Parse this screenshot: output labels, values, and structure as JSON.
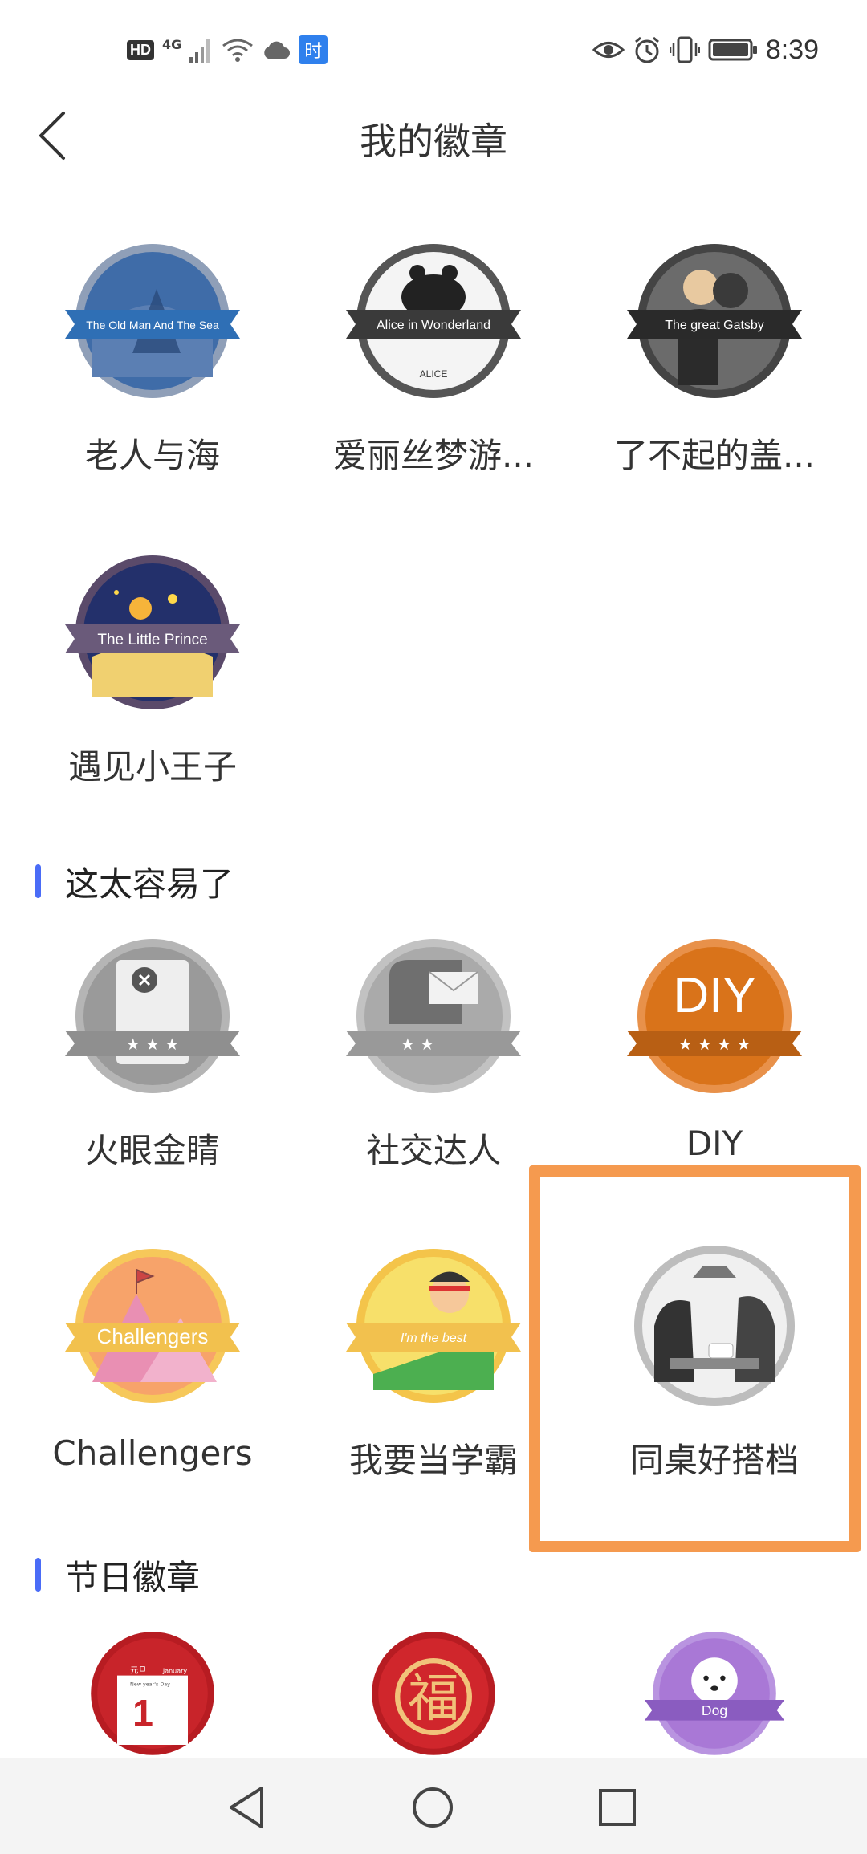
{
  "status_bar": {
    "hd_label": "HD",
    "network_label": "4G",
    "app_chip_label": "时",
    "time": "8:39",
    "icons": [
      "hd-icon",
      "signal-icon",
      "wifi-icon",
      "cloud-icon",
      "app-icon",
      "eye-icon",
      "alarm-icon",
      "vibrate-icon",
      "battery-icon"
    ]
  },
  "header": {
    "title": "我的徽章",
    "back_icon": "chevron-left-icon"
  },
  "badges_books": [
    {
      "label": "老人与海",
      "art_text": "The Old Man And The Sea"
    },
    {
      "label": "爱丽丝梦游...",
      "art_text": "Alice in Wonderland",
      "art_sub": "ALICE"
    },
    {
      "label": "了不起的盖...",
      "art_text": "The great Gatsby"
    },
    {
      "label": "遇见小王子",
      "art_text": "The Little Prince"
    }
  ],
  "section_easy": {
    "title": "这太容易了",
    "badges": [
      {
        "label": "火眼金睛"
      },
      {
        "label": "社交达人"
      },
      {
        "label": "DIY",
        "art_text": "DIY"
      },
      {
        "label": "Challengers",
        "art_text": "Challengers"
      },
      {
        "label": "我要当学霸",
        "art_text": "I'm the best"
      },
      {
        "label": "同桌好搭档"
      }
    ]
  },
  "section_holiday": {
    "title": "节日徽章",
    "badges": [
      {
        "art_text": "元旦",
        "art_sub": "January",
        "art_num": "1",
        "art_small": "New year's Day"
      },
      {
        "art_text": "福"
      },
      {
        "art_text": "Dog"
      }
    ]
  },
  "nav": {
    "back_icon": "triangle-back-icon",
    "home_icon": "circle-home-icon",
    "recent_icon": "square-recent-icon"
  },
  "colors": {
    "accent": "#4a6cf7",
    "highlight": "#f59a4f",
    "diy_orange": "#d9731a",
    "holiday_red": "#c8242a",
    "dog_purple": "#a978d6"
  }
}
